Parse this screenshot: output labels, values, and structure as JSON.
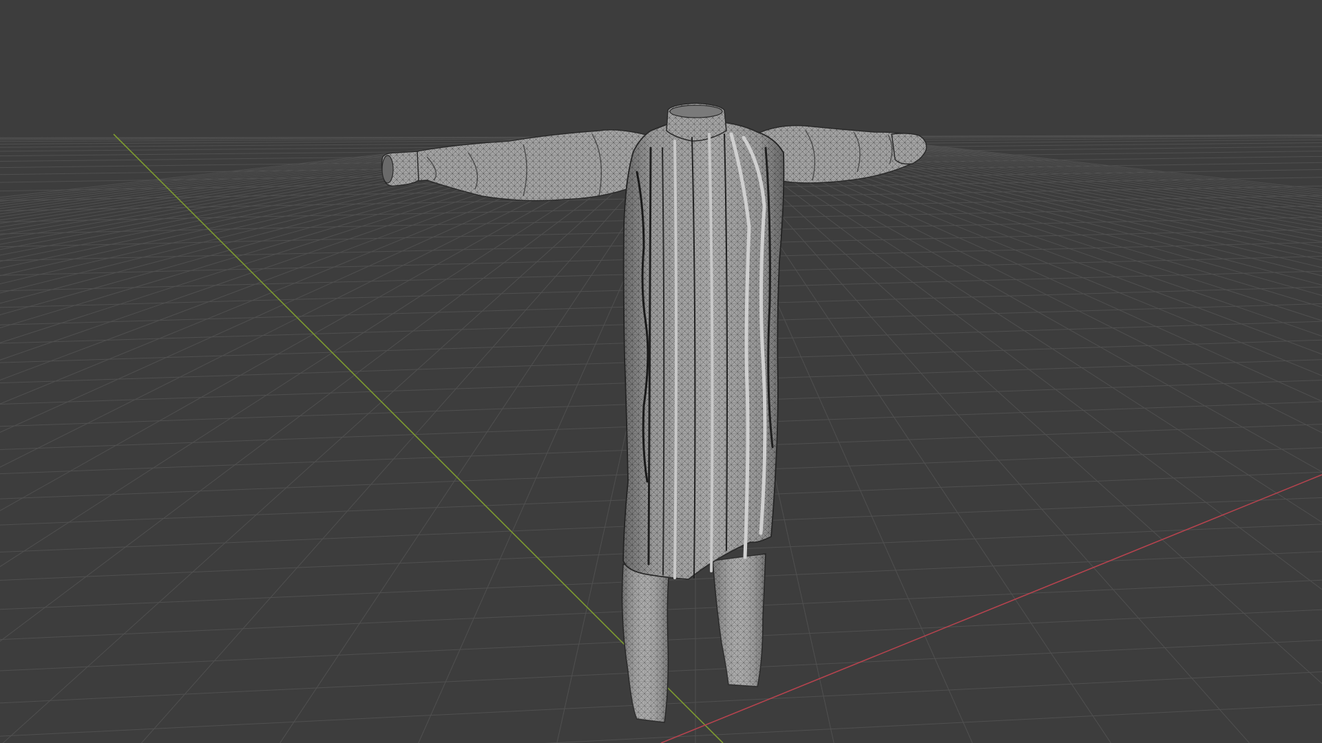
{
  "viewport": {
    "background_color": "#3d3d3d",
    "grid_color": "#505050",
    "x_axis_color": "#b5434e",
    "y_axis_color": "#7e9c30",
    "mesh_fill_color": "#9d9d9d",
    "mesh_wire_color": "#2b2b2b"
  },
  "scene": {
    "object_kind": "garment-mesh",
    "display_mode": "solid-with-wireframe",
    "grid_visible": true,
    "axes_visible": [
      "X",
      "Y"
    ]
  }
}
